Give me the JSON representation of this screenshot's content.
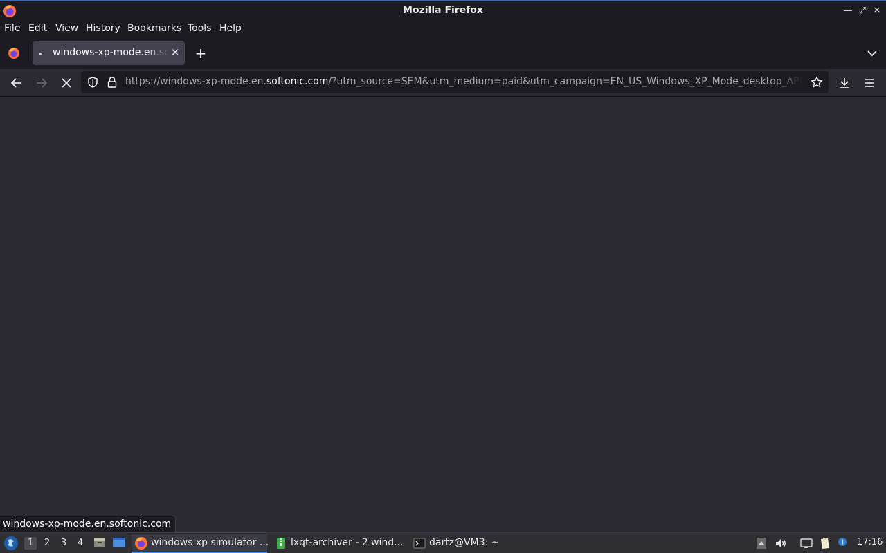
{
  "window": {
    "title": "Mozilla Firefox",
    "controls": [
      "minimize",
      "maximize",
      "close"
    ]
  },
  "menu": {
    "items": [
      "File",
      "Edit",
      "View",
      "History",
      "Bookmarks",
      "Tools",
      "Help"
    ]
  },
  "tabs": [
    {
      "label": "windows-xp-mode.en.softonic.com",
      "loading": true
    }
  ],
  "navbar": {
    "url_prefix": "https://windows-xp-mode.en.",
    "url_host": "softonic.com",
    "url_suffix": "/?utm_source=SEM&utm_medium=paid&utm_campaign=EN_US_Windows_XP_Mode_desktop_API"
  },
  "status": {
    "text": "windows-xp-mode.en.softonic.com"
  },
  "taskbar": {
    "desktops": [
      "1",
      "2",
      "3",
      "4"
    ],
    "active_desktop": "1",
    "tasks": [
      {
        "label": "windows xp simulator ...",
        "icon": "firefox-icon",
        "active": true
      },
      {
        "label": "lxqt-archiver - 2 wind...",
        "icon": "archiver-icon",
        "active": false
      },
      {
        "label": "dartz@VM3: ~",
        "icon": "terminal-icon",
        "active": false
      }
    ],
    "clock": "17:16"
  },
  "colors": {
    "chrome_dark": "#1c1b22",
    "content_bg": "#2b2a33",
    "tab_active": "#42414d",
    "accent": "#4f8fd8"
  }
}
